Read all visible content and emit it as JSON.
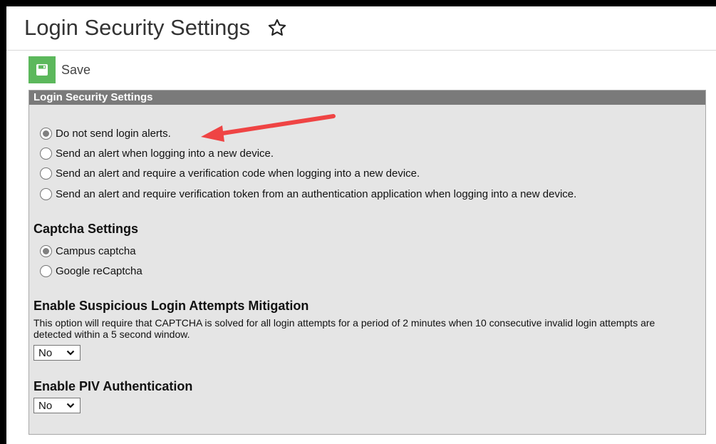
{
  "page": {
    "title": "Login Security Settings"
  },
  "toolbar": {
    "save_label": "Save"
  },
  "panel": {
    "header": "Login Security Settings",
    "login_alerts": {
      "options": [
        {
          "label": "Do not send login alerts.",
          "checked": true
        },
        {
          "label": "Send an alert when logging into a new device.",
          "checked": false
        },
        {
          "label": "Send an alert and require a verification code when logging into a new device.",
          "checked": false
        },
        {
          "label": "Send an alert and require verification token from an authentication application when logging into a new device.",
          "checked": false
        }
      ]
    },
    "captcha": {
      "heading": "Captcha Settings",
      "options": [
        {
          "label": "Campus captcha",
          "checked": true
        },
        {
          "label": "Google reCaptcha",
          "checked": false
        }
      ]
    },
    "mitigation": {
      "heading": "Enable Suspicious Login Attempts Mitigation",
      "description": "This option will require that CAPTCHA is solved for all login attempts for a period of 2 minutes when 10 consecutive invalid login attempts are detected within a 5 second window.",
      "selected": "No"
    },
    "piv": {
      "heading": "Enable PIV Authentication",
      "selected": "No"
    }
  },
  "colors": {
    "save_green": "#5cb85c",
    "panel_header": "#7a7a7a",
    "panel_bg": "#e5e5e5",
    "annotation_arrow": "#ef4444"
  }
}
